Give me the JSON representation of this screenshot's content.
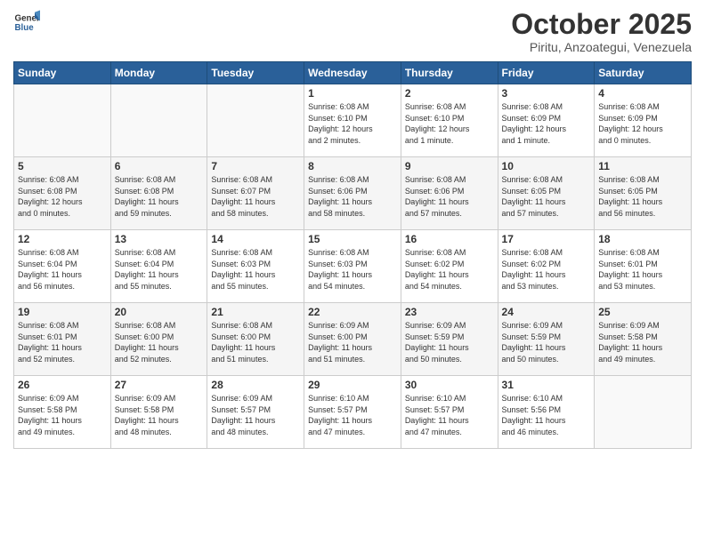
{
  "header": {
    "logo_general": "General",
    "logo_blue": "Blue",
    "title": "October 2025",
    "location": "Piritu, Anzoategui, Venezuela"
  },
  "weekdays": [
    "Sunday",
    "Monday",
    "Tuesday",
    "Wednesday",
    "Thursday",
    "Friday",
    "Saturday"
  ],
  "weeks": [
    [
      {
        "day": "",
        "info": ""
      },
      {
        "day": "",
        "info": ""
      },
      {
        "day": "",
        "info": ""
      },
      {
        "day": "1",
        "info": "Sunrise: 6:08 AM\nSunset: 6:10 PM\nDaylight: 12 hours\nand 2 minutes."
      },
      {
        "day": "2",
        "info": "Sunrise: 6:08 AM\nSunset: 6:10 PM\nDaylight: 12 hours\nand 1 minute."
      },
      {
        "day": "3",
        "info": "Sunrise: 6:08 AM\nSunset: 6:09 PM\nDaylight: 12 hours\nand 1 minute."
      },
      {
        "day": "4",
        "info": "Sunrise: 6:08 AM\nSunset: 6:09 PM\nDaylight: 12 hours\nand 0 minutes."
      }
    ],
    [
      {
        "day": "5",
        "info": "Sunrise: 6:08 AM\nSunset: 6:08 PM\nDaylight: 12 hours\nand 0 minutes."
      },
      {
        "day": "6",
        "info": "Sunrise: 6:08 AM\nSunset: 6:08 PM\nDaylight: 11 hours\nand 59 minutes."
      },
      {
        "day": "7",
        "info": "Sunrise: 6:08 AM\nSunset: 6:07 PM\nDaylight: 11 hours\nand 58 minutes."
      },
      {
        "day": "8",
        "info": "Sunrise: 6:08 AM\nSunset: 6:06 PM\nDaylight: 11 hours\nand 58 minutes."
      },
      {
        "day": "9",
        "info": "Sunrise: 6:08 AM\nSunset: 6:06 PM\nDaylight: 11 hours\nand 57 minutes."
      },
      {
        "day": "10",
        "info": "Sunrise: 6:08 AM\nSunset: 6:05 PM\nDaylight: 11 hours\nand 57 minutes."
      },
      {
        "day": "11",
        "info": "Sunrise: 6:08 AM\nSunset: 6:05 PM\nDaylight: 11 hours\nand 56 minutes."
      }
    ],
    [
      {
        "day": "12",
        "info": "Sunrise: 6:08 AM\nSunset: 6:04 PM\nDaylight: 11 hours\nand 56 minutes."
      },
      {
        "day": "13",
        "info": "Sunrise: 6:08 AM\nSunset: 6:04 PM\nDaylight: 11 hours\nand 55 minutes."
      },
      {
        "day": "14",
        "info": "Sunrise: 6:08 AM\nSunset: 6:03 PM\nDaylight: 11 hours\nand 55 minutes."
      },
      {
        "day": "15",
        "info": "Sunrise: 6:08 AM\nSunset: 6:03 PM\nDaylight: 11 hours\nand 54 minutes."
      },
      {
        "day": "16",
        "info": "Sunrise: 6:08 AM\nSunset: 6:02 PM\nDaylight: 11 hours\nand 54 minutes."
      },
      {
        "day": "17",
        "info": "Sunrise: 6:08 AM\nSunset: 6:02 PM\nDaylight: 11 hours\nand 53 minutes."
      },
      {
        "day": "18",
        "info": "Sunrise: 6:08 AM\nSunset: 6:01 PM\nDaylight: 11 hours\nand 53 minutes."
      }
    ],
    [
      {
        "day": "19",
        "info": "Sunrise: 6:08 AM\nSunset: 6:01 PM\nDaylight: 11 hours\nand 52 minutes."
      },
      {
        "day": "20",
        "info": "Sunrise: 6:08 AM\nSunset: 6:00 PM\nDaylight: 11 hours\nand 52 minutes."
      },
      {
        "day": "21",
        "info": "Sunrise: 6:08 AM\nSunset: 6:00 PM\nDaylight: 11 hours\nand 51 minutes."
      },
      {
        "day": "22",
        "info": "Sunrise: 6:09 AM\nSunset: 6:00 PM\nDaylight: 11 hours\nand 51 minutes."
      },
      {
        "day": "23",
        "info": "Sunrise: 6:09 AM\nSunset: 5:59 PM\nDaylight: 11 hours\nand 50 minutes."
      },
      {
        "day": "24",
        "info": "Sunrise: 6:09 AM\nSunset: 5:59 PM\nDaylight: 11 hours\nand 50 minutes."
      },
      {
        "day": "25",
        "info": "Sunrise: 6:09 AM\nSunset: 5:58 PM\nDaylight: 11 hours\nand 49 minutes."
      }
    ],
    [
      {
        "day": "26",
        "info": "Sunrise: 6:09 AM\nSunset: 5:58 PM\nDaylight: 11 hours\nand 49 minutes."
      },
      {
        "day": "27",
        "info": "Sunrise: 6:09 AM\nSunset: 5:58 PM\nDaylight: 11 hours\nand 48 minutes."
      },
      {
        "day": "28",
        "info": "Sunrise: 6:09 AM\nSunset: 5:57 PM\nDaylight: 11 hours\nand 48 minutes."
      },
      {
        "day": "29",
        "info": "Sunrise: 6:10 AM\nSunset: 5:57 PM\nDaylight: 11 hours\nand 47 minutes."
      },
      {
        "day": "30",
        "info": "Sunrise: 6:10 AM\nSunset: 5:57 PM\nDaylight: 11 hours\nand 47 minutes."
      },
      {
        "day": "31",
        "info": "Sunrise: 6:10 AM\nSunset: 5:56 PM\nDaylight: 11 hours\nand 46 minutes."
      },
      {
        "day": "",
        "info": ""
      }
    ]
  ]
}
